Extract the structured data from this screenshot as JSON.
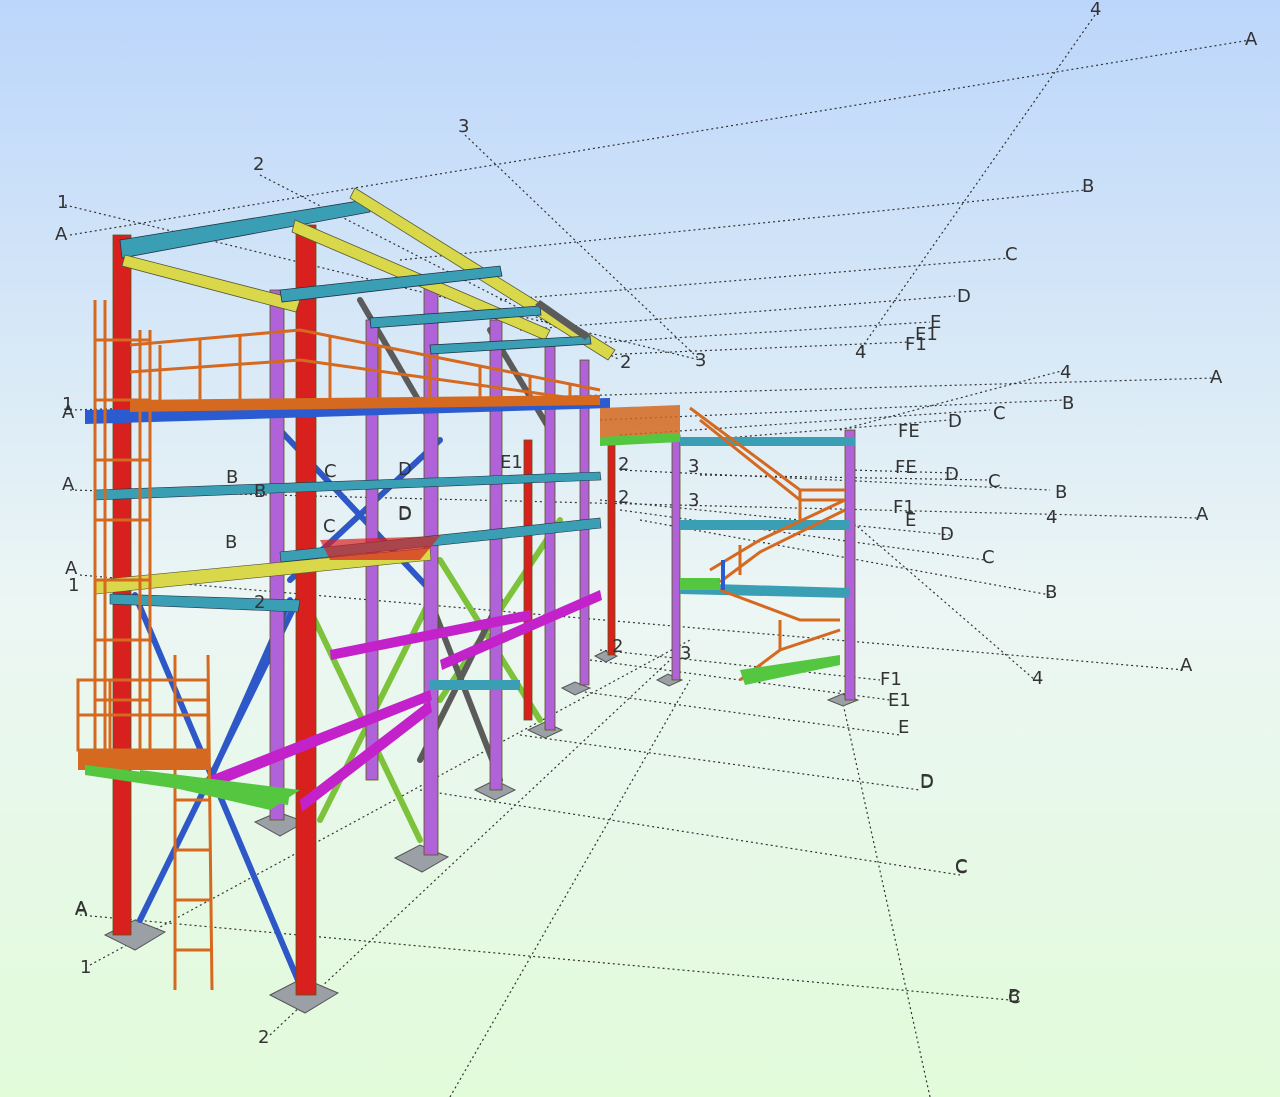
{
  "viewport": {
    "background_top": "#bcd6fb",
    "background_bottom": "#e6fbe0",
    "colors": {
      "column_red": "#d8201f",
      "column_purple": "#b062d8",
      "beam_cyan": "#3a9fb5",
      "beam_yellow": "#d8d84a",
      "beam_blue": "#2a5bd0",
      "brace_blue": "#2e58c7",
      "brace_green": "#7cc23a",
      "brace_grey": "#5b5b5b",
      "beam_magenta": "#c321c9",
      "railing_orange": "#d5691f",
      "plate_grey": "#9aa0a6",
      "floor_green": "#55c640",
      "gridline": "#333333"
    }
  },
  "grid_labels": [
    {
      "id": "g1",
      "text": "4"
    },
    {
      "id": "g2",
      "text": "A"
    },
    {
      "id": "g3",
      "text": "3"
    },
    {
      "id": "g4",
      "text": "B"
    },
    {
      "id": "g5",
      "text": "2"
    },
    {
      "id": "g6",
      "text": "C"
    },
    {
      "id": "g7",
      "text": "1"
    },
    {
      "id": "g8",
      "text": "D"
    },
    {
      "id": "g9",
      "text": "A"
    },
    {
      "id": "g10",
      "text": "E"
    },
    {
      "id": "g11",
      "text": "F1"
    },
    {
      "id": "g12",
      "text": "E1"
    },
    {
      "id": "g13",
      "text": "2"
    },
    {
      "id": "g14",
      "text": "3"
    },
    {
      "id": "g15",
      "text": "4"
    },
    {
      "id": "g16",
      "text": "4"
    },
    {
      "id": "g17",
      "text": "A"
    },
    {
      "id": "g18",
      "text": "A"
    },
    {
      "id": "g19",
      "text": "B"
    },
    {
      "id": "g20",
      "text": "C"
    },
    {
      "id": "g21",
      "text": "D"
    },
    {
      "id": "g22",
      "text": "FE"
    },
    {
      "id": "g23",
      "text": "B"
    },
    {
      "id": "g24",
      "text": "C"
    },
    {
      "id": "g25",
      "text": "D"
    },
    {
      "id": "g26",
      "text": "FE"
    },
    {
      "id": "g27",
      "text": "C"
    },
    {
      "id": "g28",
      "text": "B"
    },
    {
      "id": "g29",
      "text": "D"
    },
    {
      "id": "g30",
      "text": "E1"
    },
    {
      "id": "g31",
      "text": "2"
    },
    {
      "id": "g32",
      "text": "3"
    },
    {
      "id": "g33",
      "text": "2"
    },
    {
      "id": "g34",
      "text": "3"
    },
    {
      "id": "g35",
      "text": "4"
    },
    {
      "id": "g36",
      "text": "A"
    },
    {
      "id": "g37",
      "text": "F1"
    },
    {
      "id": "g38",
      "text": "E"
    },
    {
      "id": "g39",
      "text": "D"
    },
    {
      "id": "g40",
      "text": "C"
    },
    {
      "id": "g41",
      "text": "B"
    },
    {
      "id": "g42",
      "text": "A"
    },
    {
      "id": "g43",
      "text": "C"
    },
    {
      "id": "g44",
      "text": "D"
    },
    {
      "id": "g45",
      "text": "B"
    },
    {
      "id": "g46",
      "text": "A"
    },
    {
      "id": "g47",
      "text": "1"
    },
    {
      "id": "g48",
      "text": "A"
    },
    {
      "id": "g49",
      "text": "1"
    },
    {
      "id": "g50",
      "text": "B"
    },
    {
      "id": "g51",
      "text": "2"
    },
    {
      "id": "g52",
      "text": "3"
    },
    {
      "id": "g53",
      "text": "2"
    },
    {
      "id": "g54",
      "text": "4"
    },
    {
      "id": "g55",
      "text": "A"
    },
    {
      "id": "g56",
      "text": "C"
    },
    {
      "id": "g57",
      "text": "D"
    },
    {
      "id": "g58",
      "text": "C"
    },
    {
      "id": "g59",
      "text": "D"
    },
    {
      "id": "g60",
      "text": "E1"
    },
    {
      "id": "g61",
      "text": "F1"
    },
    {
      "id": "g62",
      "text": "E"
    },
    {
      "id": "g63",
      "text": "D"
    },
    {
      "id": "g64",
      "text": "C"
    },
    {
      "id": "g65",
      "text": "B"
    },
    {
      "id": "g66",
      "text": "A"
    },
    {
      "id": "g67",
      "text": "1"
    },
    {
      "id": "g68",
      "text": "2"
    }
  ]
}
